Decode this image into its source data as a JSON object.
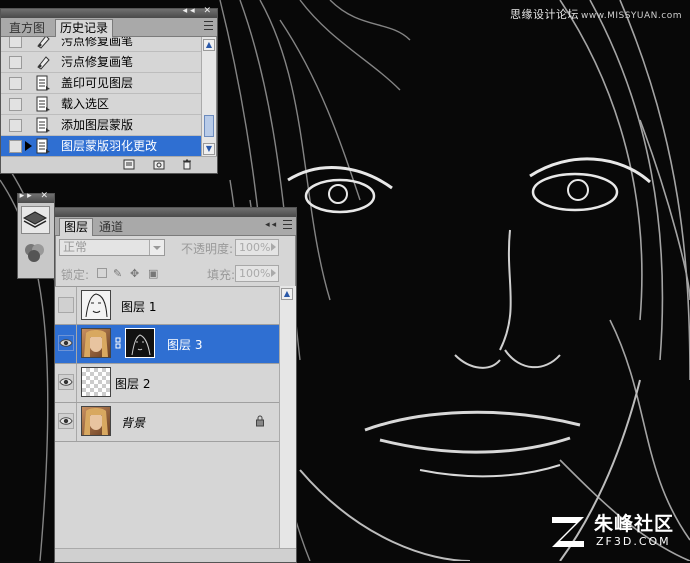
{
  "watermark": {
    "top_text": "思缘设计论坛",
    "top_url": "www.MISSYUAN.com",
    "bottom_name": "朱峰社区",
    "bottom_site": "ZF3D.COM"
  },
  "history_panel": {
    "tabs": [
      {
        "label": "直方图",
        "active": false
      },
      {
        "label": "历史记录",
        "active": true
      }
    ],
    "items": [
      {
        "label": "污点修复画笔",
        "icon": "spot-healing-brush-icon",
        "selected": false
      },
      {
        "label": "污点修复画笔",
        "icon": "spot-healing-brush-icon",
        "selected": false
      },
      {
        "label": "盖印可见图层",
        "icon": "history-state-icon",
        "selected": false
      },
      {
        "label": "载入选区",
        "icon": "history-state-icon",
        "selected": false
      },
      {
        "label": "添加图层蒙版",
        "icon": "history-state-icon",
        "selected": false
      },
      {
        "label": "图层蒙版羽化更改",
        "icon": "history-state-icon",
        "selected": true
      }
    ],
    "scroll_fraction": 0.85
  },
  "layers_panel": {
    "tabs": [
      {
        "label": "图层",
        "active": true
      },
      {
        "label": "通道",
        "active": false
      }
    ],
    "blend_mode": "正常",
    "opacity_label": "不透明度:",
    "opacity_value": "100%",
    "lock_label": "锁定:",
    "fill_label": "填充:",
    "fill_value": "100%",
    "layers": [
      {
        "name": "图层 1",
        "visible": false,
        "selected": false,
        "thumb": "sketch",
        "has_mask": false,
        "locked": false
      },
      {
        "name": "图层 3",
        "visible": true,
        "selected": true,
        "thumb": "photo",
        "has_mask": true,
        "locked": false
      },
      {
        "name": "图层 2",
        "visible": true,
        "selected": false,
        "thumb": "transparent",
        "has_mask": false,
        "locked": false
      },
      {
        "name": "背景",
        "visible": true,
        "selected": false,
        "thumb": "photo",
        "has_mask": false,
        "locked": true
      }
    ]
  },
  "colors": {
    "selection": "#2f6fd2",
    "panel_bg": "#d6d6d6",
    "canvas_bg": "#0a0a0a"
  }
}
